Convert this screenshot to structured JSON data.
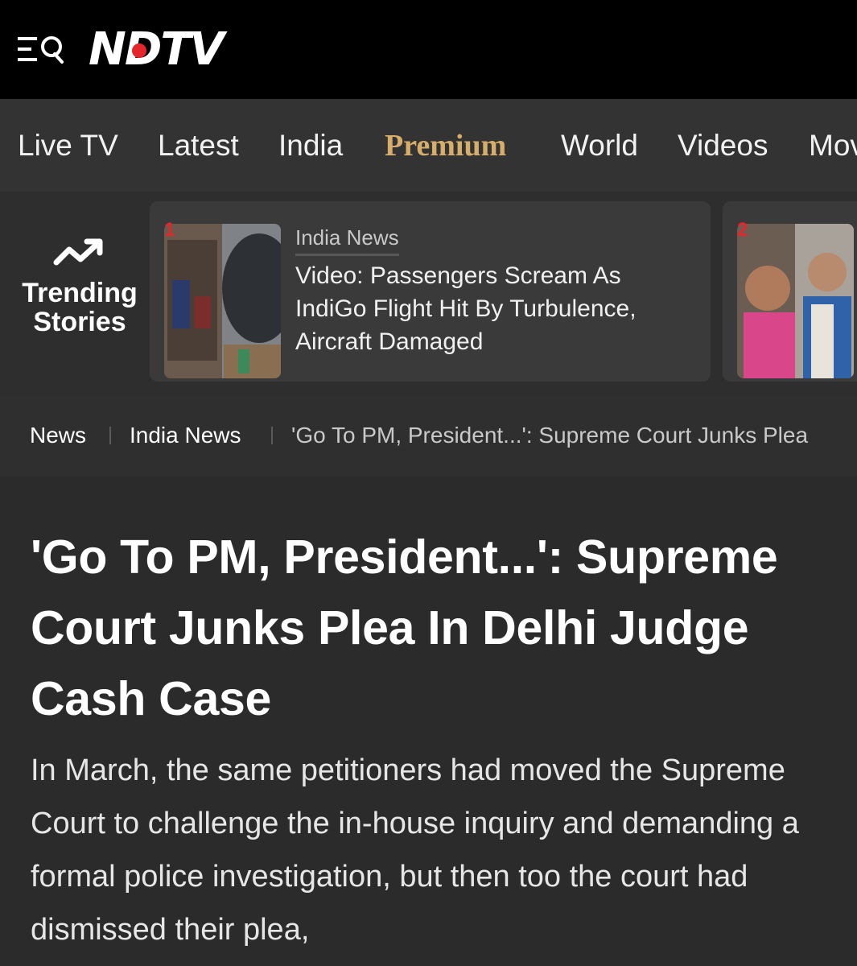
{
  "header": {
    "logo_text": "NDTV",
    "icons": [
      "menu-icon",
      "search-icon"
    ],
    "accent_color": "#e4262c"
  },
  "nav": {
    "items": [
      {
        "label": "Live TV"
      },
      {
        "label": "Latest"
      },
      {
        "label": "India"
      },
      {
        "label": "Premium"
      },
      {
        "label": "World"
      },
      {
        "label": "Videos"
      },
      {
        "label": "Mov"
      }
    ],
    "premium_color": "#d6ad6a"
  },
  "trending": {
    "label_line1": "Trending",
    "label_line2": "Stories",
    "icon": "trending-up-icon",
    "cards": [
      {
        "rank": "1",
        "category": "India News",
        "title": "Video: Passengers Scream As IndiGo Flight Hit By Turbulence, Aircraft Damaged"
      },
      {
        "rank": "2"
      }
    ]
  },
  "breadcrumb": {
    "items": [
      {
        "label": "News"
      },
      {
        "label": "India News"
      },
      {
        "label": "'Go To PM, President...': Supreme Court Junks Plea"
      }
    ]
  },
  "article": {
    "headline": "'Go To PM, President...': Supreme Court Junks Plea In Delhi Judge Cash Case",
    "summary": "In March, the same petitioners had moved the Supreme Court to challenge the in-house inquiry and demanding a formal police investigation, but then too the court had dismissed their plea,"
  }
}
